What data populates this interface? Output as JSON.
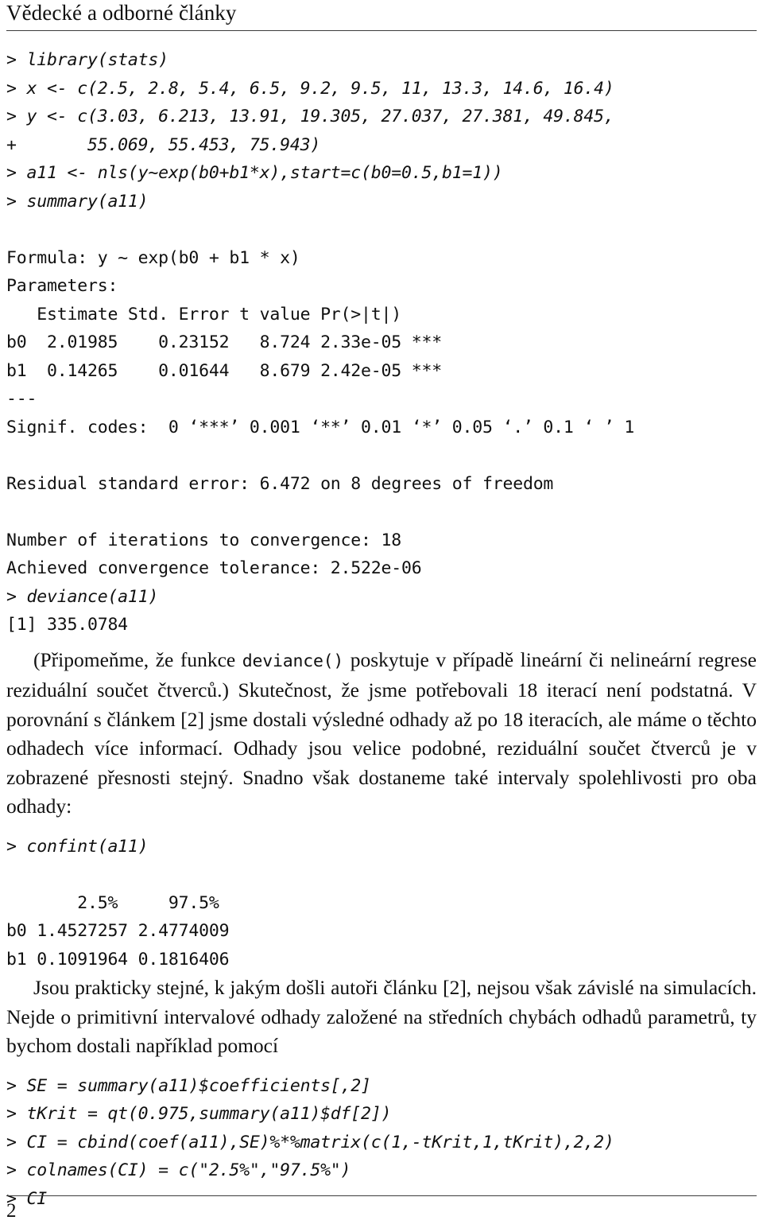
{
  "header": {
    "title": "Vědecké a odborné články"
  },
  "footer": {
    "page_number": "2"
  },
  "code_block_1": {
    "lines": [
      {
        "kind": "input",
        "text": "> library(stats)"
      },
      {
        "kind": "input",
        "text": "> x <- c(2.5, 2.8, 5.4, 6.5, 9.2, 9.5, 11, 13.3, 14.6, 16.4)"
      },
      {
        "kind": "input",
        "text": "> y <- c(3.03, 6.213, 13.91, 19.305, 27.037, 27.381, 49.845,"
      },
      {
        "kind": "input",
        "text": "+       55.069, 55.453, 75.943)"
      },
      {
        "kind": "input",
        "text": "> a11 <- nls(y~exp(b0+b1*x),start=c(b0=0.5,b1=1))"
      },
      {
        "kind": "input",
        "text": "> summary(a11)"
      },
      {
        "kind": "blank",
        "text": ""
      },
      {
        "kind": "output",
        "text": "Formula: y ~ exp(b0 + b1 * x)"
      },
      {
        "kind": "output",
        "text": "Parameters:"
      },
      {
        "kind": "output",
        "text": "   Estimate Std. Error t value Pr(>|t|)"
      },
      {
        "kind": "output",
        "text": "b0  2.01985    0.23152   8.724 2.33e-05 ***"
      },
      {
        "kind": "output",
        "text": "b1  0.14265    0.01644   8.679 2.42e-05 ***"
      },
      {
        "kind": "output",
        "text": "---"
      },
      {
        "kind": "output",
        "text": "Signif. codes:  0 ‘***’ 0.001 ‘**’ 0.01 ‘*’ 0.05 ‘.’ 0.1 ‘ ’ 1"
      },
      {
        "kind": "blank",
        "text": ""
      },
      {
        "kind": "output",
        "text": "Residual standard error: 6.472 on 8 degrees of freedom"
      },
      {
        "kind": "blank",
        "text": ""
      },
      {
        "kind": "output",
        "text": "Number of iterations to convergence: 18"
      },
      {
        "kind": "output",
        "text": "Achieved convergence tolerance: 2.522e-06"
      },
      {
        "kind": "input",
        "text": "> deviance(a11)"
      },
      {
        "kind": "output",
        "text": "[1] 335.0784"
      }
    ]
  },
  "paragraph_1": {
    "part_1": "(Připomeňme, že funkce ",
    "inline_code": "deviance()",
    "part_2": " poskytuje v případě lineární či nelineární regrese reziduální součet čtverců.) Skutečnost, že jsme potřebovali 18 iterací není podstatná. V porovnání s článkem [2] jsme dostali výsledné odhady až po 18 iteracích, ale máme o těchto odhadech více informací. Odhady jsou velice podobné, reziduální součet čtverců je v zobrazené přesnosti stejný. Snadno však dostaneme také intervaly spolehlivosti pro oba odhady:"
  },
  "code_block_2": {
    "lines": [
      {
        "kind": "input",
        "text": "> confint(a11)"
      },
      {
        "kind": "blank",
        "text": ""
      },
      {
        "kind": "output",
        "text": "       2.5%     97.5%"
      },
      {
        "kind": "output",
        "text": "b0 1.4527257 2.4774009"
      },
      {
        "kind": "output",
        "text": "b1 0.1091964 0.1816406"
      }
    ]
  },
  "paragraph_2": {
    "text": "Jsou prakticky stejné, k jakým došli autoři článku [2], nejsou však závislé na simulacích. Nejde o primitivní intervalové odhady založené na středních chybách odhadů parametrů, ty bychom dostali například pomocí"
  },
  "code_block_3": {
    "lines": [
      {
        "kind": "input",
        "text": "> SE = summary(a11)$coefficients[,2]"
      },
      {
        "kind": "input",
        "text": "> tKrit = qt(0.975,summary(a11)$df[2])"
      },
      {
        "kind": "input",
        "text": "> CI = cbind(coef(a11),SE)%*%matrix(c(1,-tKrit,1,tKrit),2,2)"
      },
      {
        "kind": "input",
        "text": "> colnames(CI) = c(\"2.5%\",\"97.5%\")"
      },
      {
        "kind": "input",
        "text": "> CI"
      }
    ]
  },
  "colors": {
    "text": "#101010",
    "rule": "#3c3c3c",
    "background": "#ffffff"
  }
}
